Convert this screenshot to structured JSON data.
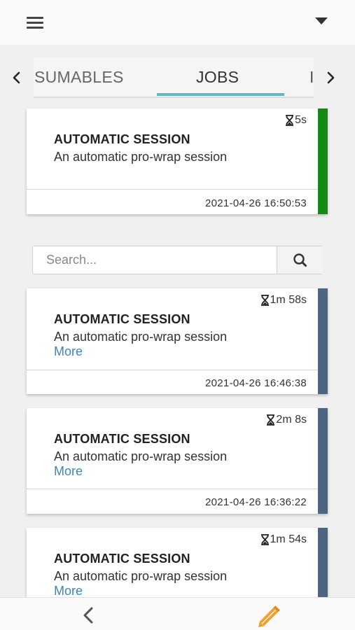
{
  "header": {
    "menu_icon": "hamburger-icon",
    "dropdown_icon": "caret-down-icon"
  },
  "tabs": {
    "prev_icon": "chevron-left-icon",
    "next_icon": "chevron-right-icon",
    "items": [
      {
        "label": "SUMABLES"
      },
      {
        "label": "JOBS",
        "active": true
      },
      {
        "label": "I"
      }
    ],
    "accent_color": "#5fb9c3"
  },
  "active_job": {
    "duration": "5s",
    "title": "AUTOMATIC SESSION",
    "description": "An automatic pro-wrap session",
    "timestamp": "2021-04-26 16:50:53",
    "status_color": "#148a14"
  },
  "search": {
    "placeholder": "Search...",
    "value": "",
    "button_icon": "search-icon"
  },
  "jobs": [
    {
      "duration": "1m 58s",
      "title": "AUTOMATIC SESSION",
      "description": "An automatic pro-wrap session",
      "more": "More",
      "timestamp": "2021-04-26 16:46:38"
    },
    {
      "duration": "2m 8s",
      "title": "AUTOMATIC SESSION",
      "description": "An automatic pro-wrap session",
      "more": "More",
      "timestamp": "2021-04-26 16:36:22"
    },
    {
      "duration": "1m 54s",
      "title": "AUTOMATIC SESSION",
      "description": "An automatic pro-wrap session",
      "more": "More"
    }
  ],
  "job_stripe_color": "#4d6580",
  "bottom": {
    "back_icon": "chevron-left-icon",
    "edit_icon": "pencil-icon",
    "edit_color": "#f0a030"
  }
}
